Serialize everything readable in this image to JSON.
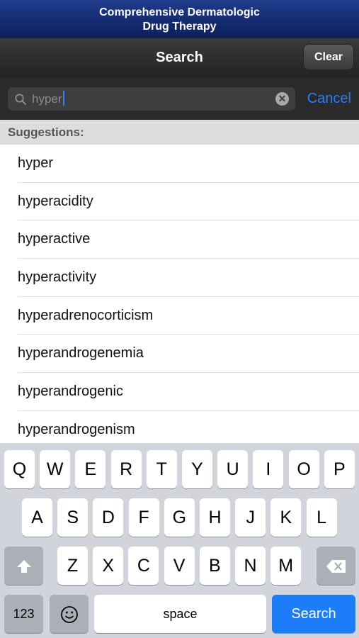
{
  "app": {
    "title_line1": "Comprehensive Dermatologic",
    "title_line2": "Drug Therapy"
  },
  "nav": {
    "title": "Search",
    "clear_label": "Clear"
  },
  "search": {
    "query": "hyper",
    "cancel_label": "Cancel",
    "icon": "search-icon",
    "clear_icon": "close-circle-icon"
  },
  "suggestions": {
    "header": "Suggestions:",
    "items": [
      "hyper",
      "hyperacidity",
      "hyperactive",
      "hyperactivity",
      "hyperadrenocorticism",
      "hyperandrogenemia",
      "hyperandrogenic",
      "hyperandrogenism"
    ]
  },
  "keyboard": {
    "row1": [
      "Q",
      "W",
      "E",
      "R",
      "T",
      "Y",
      "U",
      "I",
      "O",
      "P"
    ],
    "row2": [
      "A",
      "S",
      "D",
      "F",
      "G",
      "H",
      "J",
      "K",
      "L"
    ],
    "row3": [
      "Z",
      "X",
      "C",
      "V",
      "B",
      "N",
      "M"
    ],
    "numbers_label": "123",
    "space_label": "space",
    "search_label": "Search",
    "icons": {
      "shift": "shift-icon",
      "emoji": "emoji-icon",
      "delete": "backspace-icon"
    }
  },
  "colors": {
    "accent": "#2f7df6",
    "banner": "#1f3c8c",
    "search_key": "#1d7cf7"
  }
}
